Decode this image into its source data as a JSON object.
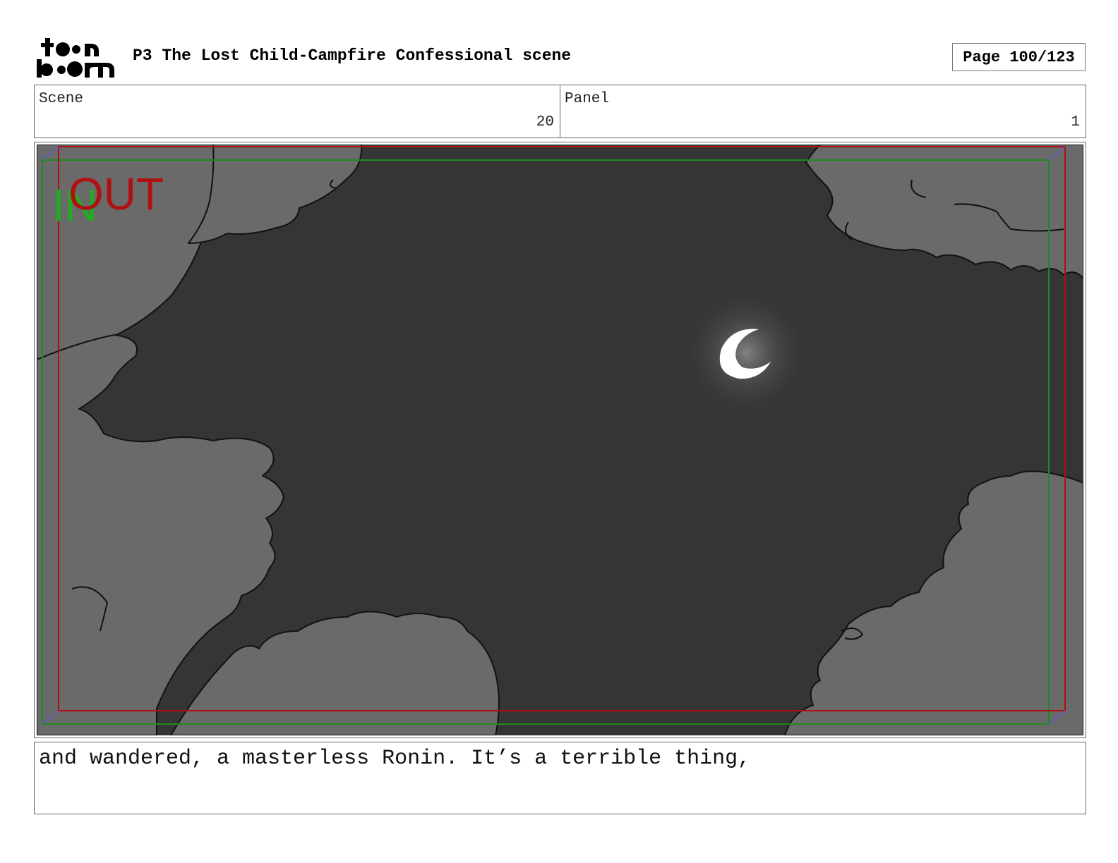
{
  "header": {
    "logo_text": "toon boom",
    "title": "P3 The Lost Child-Campfire Confessional scene",
    "page_label": "Page 100/123"
  },
  "info": {
    "scene_label": "Scene",
    "scene_value": "20",
    "panel_label": "Panel",
    "panel_value": "1"
  },
  "panel": {
    "in_label": "IN",
    "out_label": "OUT",
    "colors": {
      "sky": "#353535",
      "foliage": "#6a6a6a",
      "in_frame": "#1f8a1f",
      "out_frame": "#b01010",
      "moon": "#ffffff"
    }
  },
  "caption": {
    "text": "and wandered, a masterless Ronin. It’s a terrible thing,"
  }
}
